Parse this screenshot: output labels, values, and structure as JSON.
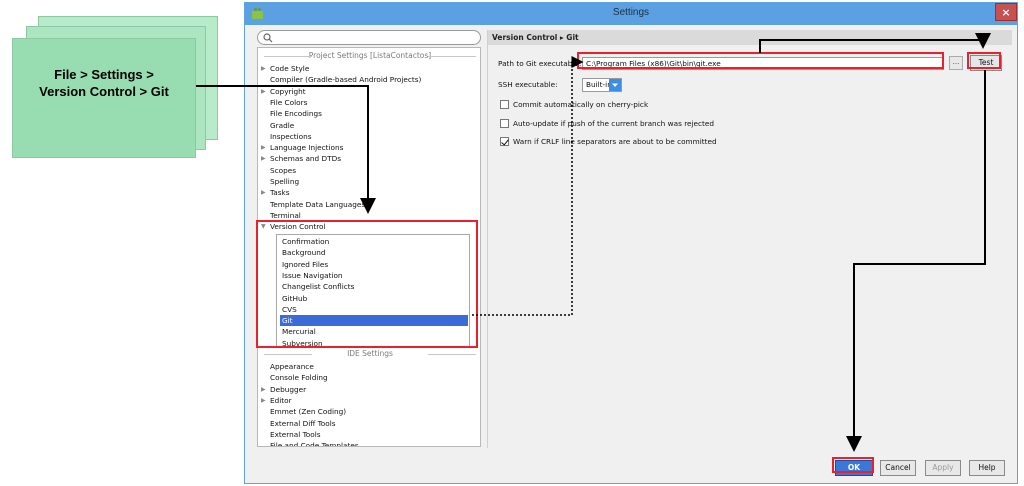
{
  "callout": {
    "line1": "File > Settings >",
    "line2": "Version Control > Git"
  },
  "window": {
    "title": "Settings",
    "close_glyph": "×"
  },
  "search": {
    "placeholder": ""
  },
  "tree": {
    "project_header": "Project Settings [ListaContactos]",
    "ide_header": "IDE Settings",
    "project_items": [
      {
        "label": "Code Style",
        "expandable": true
      },
      {
        "label": "Compiler (Gradle-based Android Projects)",
        "expandable": false
      },
      {
        "label": "Copyright",
        "expandable": true
      },
      {
        "label": "File Colors",
        "expandable": false
      },
      {
        "label": "File Encodings",
        "expandable": false
      },
      {
        "label": "Gradle",
        "expandable": false
      },
      {
        "label": "Inspections",
        "expandable": false
      },
      {
        "label": "Language Injections",
        "expandable": true
      },
      {
        "label": "Schemas and DTDs",
        "expandable": true
      },
      {
        "label": "Scopes",
        "expandable": false
      },
      {
        "label": "Spelling",
        "expandable": false
      },
      {
        "label": "Tasks",
        "expandable": true
      },
      {
        "label": "Template Data Languages",
        "expandable": false
      },
      {
        "label": "Terminal",
        "expandable": false
      },
      {
        "label": "Version Control",
        "expandable": true
      }
    ],
    "version_control_children": [
      "Confirmation",
      "Background",
      "Ignored Files",
      "Issue Navigation",
      "Changelist Conflicts",
      "GitHub",
      "CVS",
      "Git",
      "Mercurial",
      "Subversion"
    ],
    "selected": "Git",
    "ide_items": [
      {
        "label": "Appearance",
        "expandable": false
      },
      {
        "label": "Console Folding",
        "expandable": false
      },
      {
        "label": "Debugger",
        "expandable": true
      },
      {
        "label": "Editor",
        "expandable": true
      },
      {
        "label": "Emmet (Zen Coding)",
        "expandable": false
      },
      {
        "label": "External Diff Tools",
        "expandable": false
      },
      {
        "label": "External Tools",
        "expandable": false
      },
      {
        "label": "File and Code Templates",
        "expandable": false
      }
    ]
  },
  "panel": {
    "breadcrumb": "Version Control ▸ Git",
    "path_label": "Path to Git executable:",
    "path_value": "C:\\Program Files (x86)\\Git\\bin\\git.exe",
    "browse_label": "...",
    "test_label": "Test",
    "ssh_label": "SSH executable:",
    "ssh_value": "Built-in",
    "checkboxes": [
      {
        "label": "Commit automatically on cherry-pick",
        "checked": false
      },
      {
        "label": "Auto-update if push of the current branch was rejected",
        "checked": false
      },
      {
        "label": "Warn if CRLF line separators are about to be committed",
        "checked": true
      }
    ]
  },
  "footer": {
    "ok": "OK",
    "cancel": "Cancel",
    "apply": "Apply",
    "help": "Help"
  },
  "colors": {
    "titlebar": "#5ba0e0",
    "selection": "#3a6bd8",
    "highlight": "#e8212f",
    "callout": "#98dcb2"
  }
}
